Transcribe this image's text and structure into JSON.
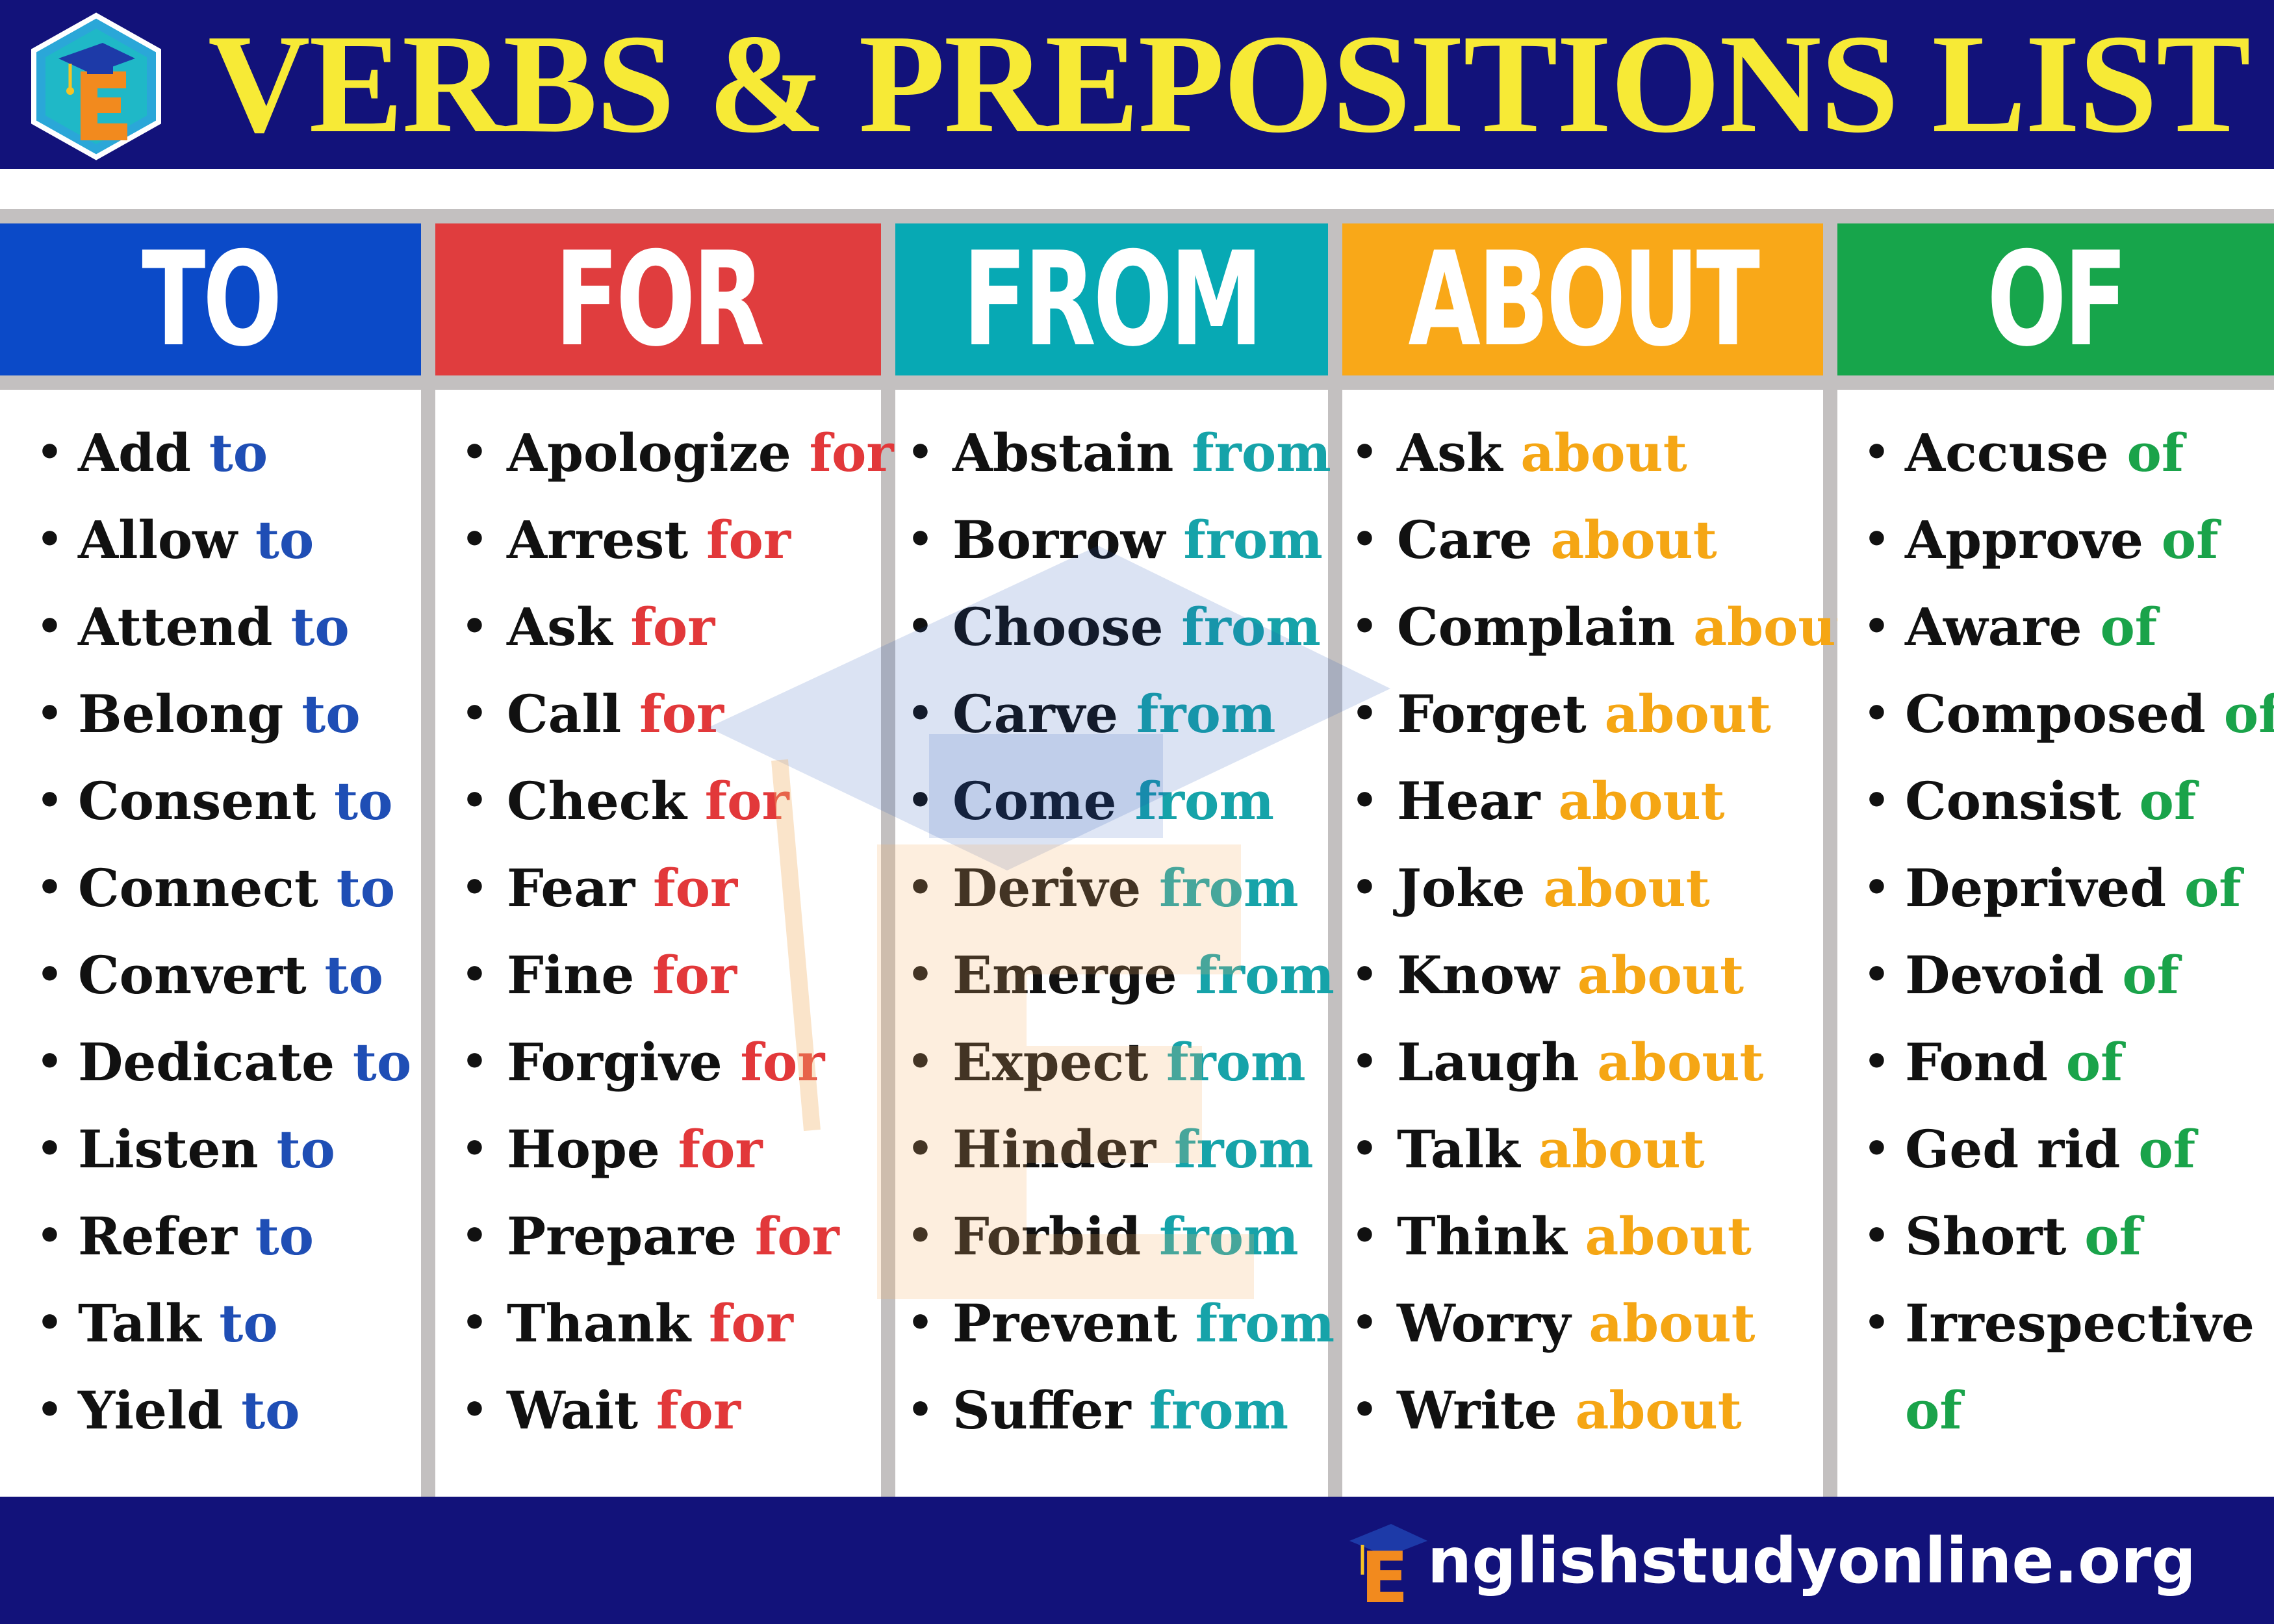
{
  "header": {
    "title": "VERBS  & PREPOSITIONS LIST",
    "logo_icon": "e-graduation-cap-logo-icon"
  },
  "colors": {
    "header_bg": "#12127a",
    "title": "#f7ea36",
    "to": "#0b4ac8",
    "for": "#e03d3e",
    "from": "#07a9b4",
    "about": "#f9a818",
    "of": "#17a54b",
    "separator": "#c3c0c0"
  },
  "columns": [
    {
      "heading": "TO",
      "preposition": "to",
      "items": [
        "Add",
        "Allow",
        "Attend",
        "Belong",
        "Consent",
        "Connect",
        "Convert",
        "Dedicate",
        "Listen",
        "Refer",
        "Talk",
        "Yield"
      ]
    },
    {
      "heading": "FOR",
      "preposition": "for",
      "items": [
        "Apologize",
        "Arrest",
        "Ask",
        "Call",
        "Check",
        "Fear",
        "Fine",
        "Forgive",
        "Hope",
        "Prepare",
        "Thank",
        "Wait"
      ]
    },
    {
      "heading": "FROM",
      "preposition": "from",
      "items": [
        "Abstain",
        "Borrow",
        "Choose",
        "Carve",
        "Come",
        "Derive",
        "Emerge",
        "Expect",
        "Hinder",
        "Forbid",
        "Prevent",
        "Suffer"
      ]
    },
    {
      "heading": "ABOUT",
      "preposition": "about",
      "items": [
        "Ask",
        "Care",
        "Complain",
        "Forget",
        "Hear",
        "Joke",
        "Know",
        "Laugh",
        "Talk",
        "Think",
        "Worry",
        "Write"
      ]
    },
    {
      "heading": "OF",
      "preposition": "of",
      "items": [
        "Accuse",
        "Approve",
        "Aware",
        "Composed",
        "Consist",
        "Deprived",
        "Devoid",
        "Fond",
        "Ged rid",
        "Short",
        "Irrespective"
      ]
    }
  ],
  "footer": {
    "brand_initial": "E",
    "brand_rest": "nglishstudyonline.org",
    "logo_icon": "e-graduation-cap-logo-icon"
  }
}
